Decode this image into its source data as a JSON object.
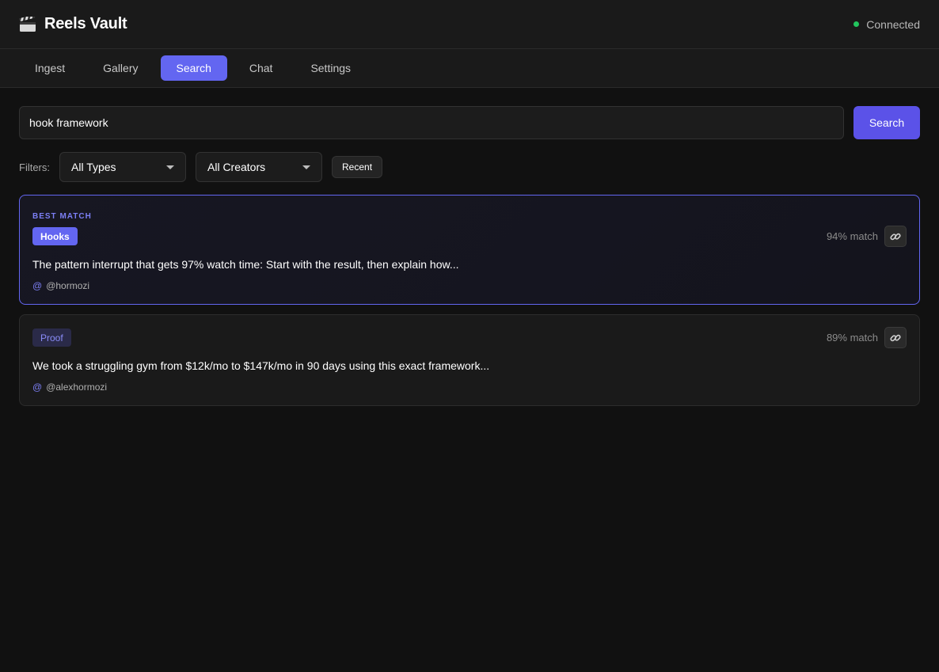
{
  "app": {
    "title": "Reels Vault",
    "logo_icon": "clapperboard-icon"
  },
  "status": {
    "label": "Connected",
    "color": "#22c55e"
  },
  "tabs": [
    {
      "label": "Ingest",
      "active": false
    },
    {
      "label": "Gallery",
      "active": false
    },
    {
      "label": "Search",
      "active": true
    },
    {
      "label": "Chat",
      "active": false
    },
    {
      "label": "Settings",
      "active": false
    }
  ],
  "search": {
    "value": "hook framework",
    "button_label": "Search"
  },
  "filters": {
    "label": "Filters:",
    "type_selected": "All Types",
    "creator_selected": "All Creators",
    "recent_label": "Recent"
  },
  "results": [
    {
      "badge": "BEST MATCH",
      "tag": "Hooks",
      "match": "94% match",
      "text": "The pattern interrupt that gets 97% watch time: Start with the result, then explain how...",
      "at_symbol": "@",
      "creator": "@hormozi"
    },
    {
      "tag": "Proof",
      "match": "89% match",
      "text": "We took a struggling gym from $12k/mo to $147k/mo in 90 days using this exact framework...",
      "at_symbol": "@",
      "creator": "@alexhormozi"
    }
  ],
  "colors": {
    "accent": "#6366f1",
    "background": "#111111",
    "panel": "#1a1a1a"
  }
}
